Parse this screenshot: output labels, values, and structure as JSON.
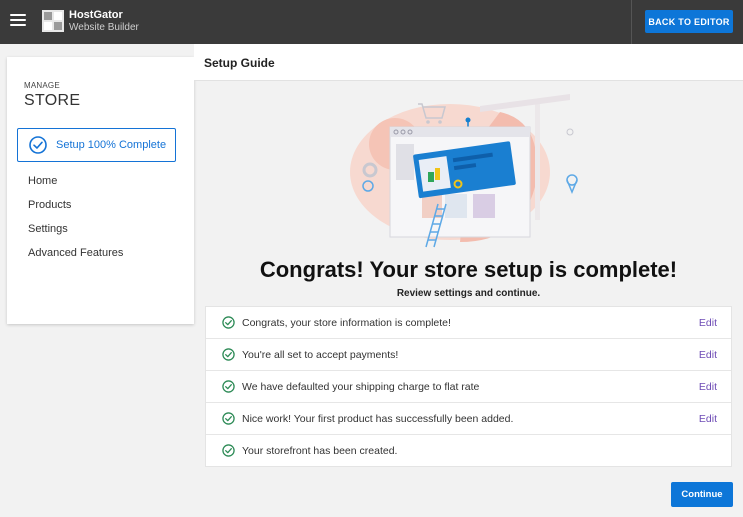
{
  "header": {
    "brand_name": "HostGator",
    "brand_sub": "Website Builder",
    "back_label": "BACK TO EDITOR"
  },
  "sidebar": {
    "manage_small": "MANAGE",
    "manage_big": "STORE",
    "setup_label": "Setup 100% Complete",
    "items": [
      {
        "label": "Home"
      },
      {
        "label": "Products"
      },
      {
        "label": "Settings"
      },
      {
        "label": "Advanced Features"
      }
    ]
  },
  "main": {
    "title": "Setup Guide",
    "congrats": "Congrats! Your store setup is complete!",
    "subtitle": "Review settings and continue.",
    "checklist": [
      {
        "text": "Congrats, your store information is complete!",
        "edit": "Edit"
      },
      {
        "text": "You're all set to accept payments!",
        "edit": "Edit"
      },
      {
        "text": "We have defaulted your shipping charge to flat rate",
        "edit": "Edit"
      },
      {
        "text": "Nice work! Your first product has successfully been added.",
        "edit": "Edit"
      },
      {
        "text": "Your storefront has been created."
      }
    ],
    "continue_label": "Continue"
  },
  "colors": {
    "topbar": "#3a3a3a",
    "accent": "#0d76d8",
    "check_green": "#2e8b57",
    "edit_link": "#6d4bb5"
  }
}
